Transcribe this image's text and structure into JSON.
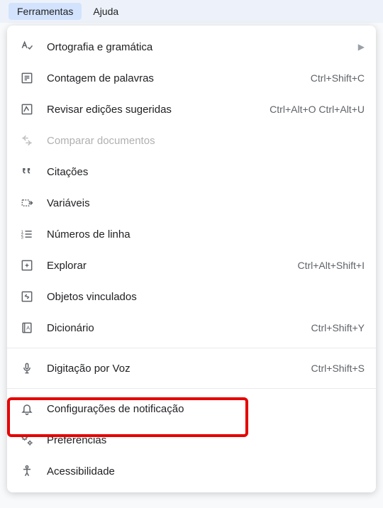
{
  "menubar": {
    "tools": "Ferramentas",
    "help": "Ajuda"
  },
  "menu": {
    "spelling": {
      "label": "Ortografia e gramática"
    },
    "wordcount": {
      "label": "Contagem de palavras",
      "shortcut": "Ctrl+Shift+C"
    },
    "review": {
      "label": "Revisar edições sugeridas",
      "shortcut": "Ctrl+Alt+O Ctrl+Alt+U"
    },
    "compare": {
      "label": "Comparar documentos"
    },
    "citations": {
      "label": "Citações"
    },
    "variables": {
      "label": "Variáveis"
    },
    "linenumbers": {
      "label": "Números de linha"
    },
    "explore": {
      "label": "Explorar",
      "shortcut": "Ctrl+Alt+Shift+I"
    },
    "linked": {
      "label": "Objetos vinculados"
    },
    "dictionary": {
      "label": "Dicionário",
      "shortcut": "Ctrl+Shift+Y"
    },
    "voice": {
      "label": "Digitação por Voz",
      "shortcut": "Ctrl+Shift+S"
    },
    "notifications": {
      "label": "Configurações de notificação"
    },
    "preferences": {
      "label": "Preferências"
    },
    "accessibility": {
      "label": "Acessibilidade"
    }
  }
}
